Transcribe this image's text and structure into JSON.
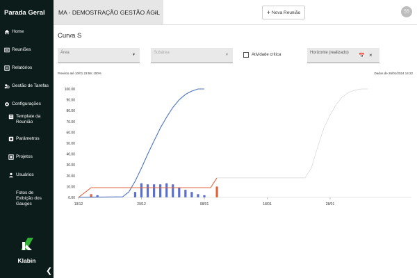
{
  "sidebar": {
    "title": "Parada Geral",
    "items": [
      {
        "label": "Home",
        "icon": "home-icon"
      },
      {
        "label": "Reuniões",
        "icon": "meetings-icon"
      },
      {
        "label": "Relatórios",
        "icon": "reports-icon"
      },
      {
        "label": "Gestão de Tarefas",
        "icon": "tasks-icon"
      },
      {
        "label": "Configurações",
        "icon": "settings-icon"
      },
      {
        "label": "Template da\nReunião",
        "icon": "template-icon"
      },
      {
        "label": "Parâmetros",
        "icon": "parameters-icon"
      },
      {
        "label": "Projetos",
        "icon": "projects-icon"
      },
      {
        "label": "Usuários",
        "icon": "users-icon"
      },
      {
        "label": "Fotos de\nExibição dos\nGauges",
        "icon": "photos-icon"
      }
    ],
    "logo_text": "Klabin",
    "logo_color": "#2eb135",
    "collapse_glyph": "❮"
  },
  "topbar": {
    "project": "MA - DEMOSTRAÇÃO GESTÃO ÁGIL",
    "new_meeting": "Nova Reunião",
    "avatar_initials": "SS"
  },
  "page": {
    "title": "Curva S",
    "filters": {
      "area_placeholder": "Área",
      "subarea_placeholder": "Subárea",
      "critical_label": "Atividade crítica",
      "horizon_placeholder": "Horizonte (realizado)"
    },
    "info_left": "Previsto até 10/01 23:59: 100%",
    "info_right": "Dados de 26/01/2024 14:22"
  },
  "chart_data": {
    "type": "line",
    "title": "",
    "x_tick_labels": [
      "19/12",
      "29/12",
      "08/01",
      "18/01",
      "28/01"
    ],
    "y_tick_labels": [
      "0.00",
      "10.00",
      "20.00",
      "30.00",
      "40.00",
      "50.00",
      "60.00",
      "70.00",
      "80.00",
      "90.00",
      "100.00"
    ],
    "ylim": [
      0,
      100
    ],
    "colors": {
      "planned_line": "#4a72c4",
      "bars": "#5b6fd0",
      "orange": "#e0643c",
      "grey_line": "#d6d6d6"
    },
    "series": [
      {
        "values": [
          {
            "x": "2023-12-19",
            "y": 0
          },
          {
            "x": "2023-12-26",
            "y": 0.5
          },
          {
            "x": "2023-12-27",
            "y": 5
          },
          {
            "x": "2023-12-28",
            "y": 15
          },
          {
            "x": "2023-12-29",
            "y": 27
          },
          {
            "x": "2023-12-30",
            "y": 40
          },
          {
            "x": "2023-12-31",
            "y": 52
          },
          {
            "x": "2024-01-01",
            "y": 64
          },
          {
            "x": "2024-01-02",
            "y": 74
          },
          {
            "x": "2024-01-03",
            "y": 83
          },
          {
            "x": "2024-01-04",
            "y": 90
          },
          {
            "x": "2024-01-05",
            "y": 95
          },
          {
            "x": "2024-01-06",
            "y": 98
          },
          {
            "x": "2024-01-07",
            "y": 100
          },
          {
            "x": "2024-01-08",
            "y": 100
          }
        ]
      },
      {
        "values": [
          {
            "x": "2023-12-19",
            "y": 0
          },
          {
            "x": "2023-12-21",
            "y": 9
          },
          {
            "x": "2024-01-09",
            "y": 9
          },
          {
            "x": "2024-01-10",
            "y": 18
          }
        ]
      },
      {
        "values": [
          {
            "x": "2024-01-10",
            "y": 18
          },
          {
            "x": "2024-01-24",
            "y": 18
          },
          {
            "x": "2024-01-25",
            "y": 27
          },
          {
            "x": "2024-01-26",
            "y": 46
          },
          {
            "x": "2024-01-27",
            "y": 64
          },
          {
            "x": "2024-01-28",
            "y": 76
          },
          {
            "x": "2024-01-29",
            "y": 86
          },
          {
            "x": "2024-01-30",
            "y": 93
          },
          {
            "x": "2024-01-31",
            "y": 97
          },
          {
            "x": "2024-02-01",
            "y": 99
          },
          {
            "x": "2024-02-02",
            "y": 100
          },
          {
            "x": "2024-02-03",
            "y": 100
          }
        ]
      }
    ],
    "bars": [
      {
        "x": "2023-12-21",
        "y": 3,
        "color": "orange"
      },
      {
        "x": "2023-12-22",
        "y": 2,
        "color": "blue"
      },
      {
        "x": "2023-12-28",
        "y": 5,
        "color": "blue"
      },
      {
        "x": "2023-12-29",
        "y": 13,
        "color": "blue"
      },
      {
        "x": "2023-12-30",
        "y": 12,
        "color": "blue"
      },
      {
        "x": "2023-12-31",
        "y": 12,
        "color": "blue"
      },
      {
        "x": "2024-01-01",
        "y": 12,
        "color": "blue"
      },
      {
        "x": "2024-01-02",
        "y": 13,
        "color": "blue"
      },
      {
        "x": "2024-01-03",
        "y": 12,
        "color": "blue"
      },
      {
        "x": "2024-01-04",
        "y": 9,
        "color": "blue"
      },
      {
        "x": "2024-01-05",
        "y": 7,
        "color": "blue"
      },
      {
        "x": "2024-01-06",
        "y": 5,
        "color": "blue"
      },
      {
        "x": "2024-01-07",
        "y": 3,
        "color": "blue"
      },
      {
        "x": "2024-01-08",
        "y": 2,
        "color": "blue"
      },
      {
        "x": "2024-01-10",
        "y": 10,
        "color": "orange"
      }
    ]
  }
}
